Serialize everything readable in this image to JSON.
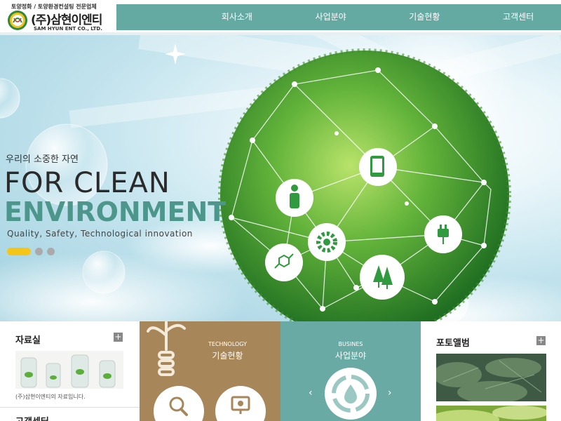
{
  "header": {
    "tagline": "토양정화 / 토양환경컨설팅 전문업체",
    "company_name": "(주)삼현이엔티",
    "company_name_en": "SAM HYUN ENT CO., LTD.",
    "logo_icon": "samhyun-logo",
    "nav": [
      {
        "label": "회사소개"
      },
      {
        "label": "사업분야"
      },
      {
        "label": "기술현황"
      },
      {
        "label": "고객센터"
      }
    ],
    "nav_color": "#64a9a2"
  },
  "hero": {
    "subtitle": "우리의 소중한 자연",
    "title_line1": "FOR CLEAN",
    "title_line2": "ENVIRONMENT",
    "description": "Quality, Safety, Technological innovation",
    "slides": 3,
    "active_slide": 1,
    "accent_color": "#4c968c",
    "indicator_color": "#f5c518",
    "globe_icons": [
      "mobile-icon",
      "person-icon",
      "gear-icon",
      "plug-icon",
      "trees-icon",
      "molecule-icon"
    ]
  },
  "panels": {
    "pds": {
      "title": "자료실",
      "caption": "(주)삼현이엔티의 자료입니다.",
      "more": "+"
    },
    "customer": {
      "title": "고객센터"
    },
    "tech": {
      "label_en": "TECHNOLOGY",
      "label_ko": "기술현황",
      "color": "#a7865a",
      "icons": [
        "magnifier-icon",
        "monitor-icon",
        "lightbulb-icon"
      ]
    },
    "business": {
      "label_en": "BUSINES",
      "label_ko": "사업분야",
      "color": "#6aaaa5",
      "prev": "‹",
      "next": "›",
      "icon": "recycle-water-icon"
    },
    "photo": {
      "title": "포토앨범",
      "more": "+"
    }
  }
}
